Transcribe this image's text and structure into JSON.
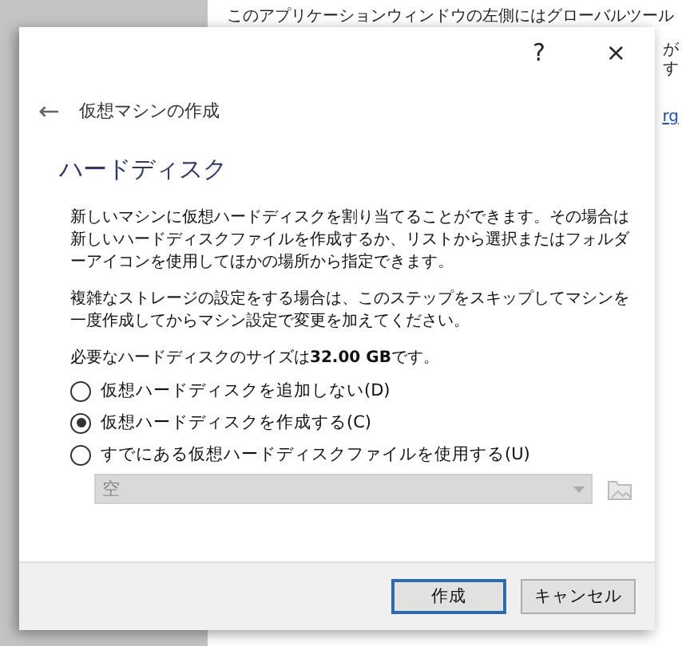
{
  "background": {
    "text": "このアプリケーションウィンドウの左側にはグローバルツール",
    "fragments": [
      "が",
      "す"
    ],
    "link": "rg"
  },
  "dialog": {
    "help": "?",
    "close": "×",
    "back": "←",
    "title": "仮想マシンの作成",
    "heading": "ハードディスク",
    "paragraphs": [
      "新しいマシンに仮想ハードディスクを割り当てることができます。その場合は新しいハードディスクファイルを作成するか、リストから選択またはフォルダーアイコンを使用してほかの場所から指定できます。",
      "複雑なストレージの設定をする場合は、このステップをスキップしてマシンを一度作成してからマシン設定で変更を加えてください。",
      "必要なハードディスクのサイズは**32.00 GB**です。"
    ],
    "options": [
      {
        "label": "仮想ハードディスクを追加しない(D)",
        "selected": false
      },
      {
        "label": "仮想ハードディスクを作成する(C)",
        "selected": true
      },
      {
        "label": "すでにある仮想ハードディスクファイルを使用する(U)",
        "selected": false
      }
    ],
    "file_select": {
      "value": "空",
      "disabled": true
    },
    "buttons": [
      {
        "label": "作成",
        "default": true
      },
      {
        "label": "キャンセル",
        "default": false
      }
    ]
  }
}
